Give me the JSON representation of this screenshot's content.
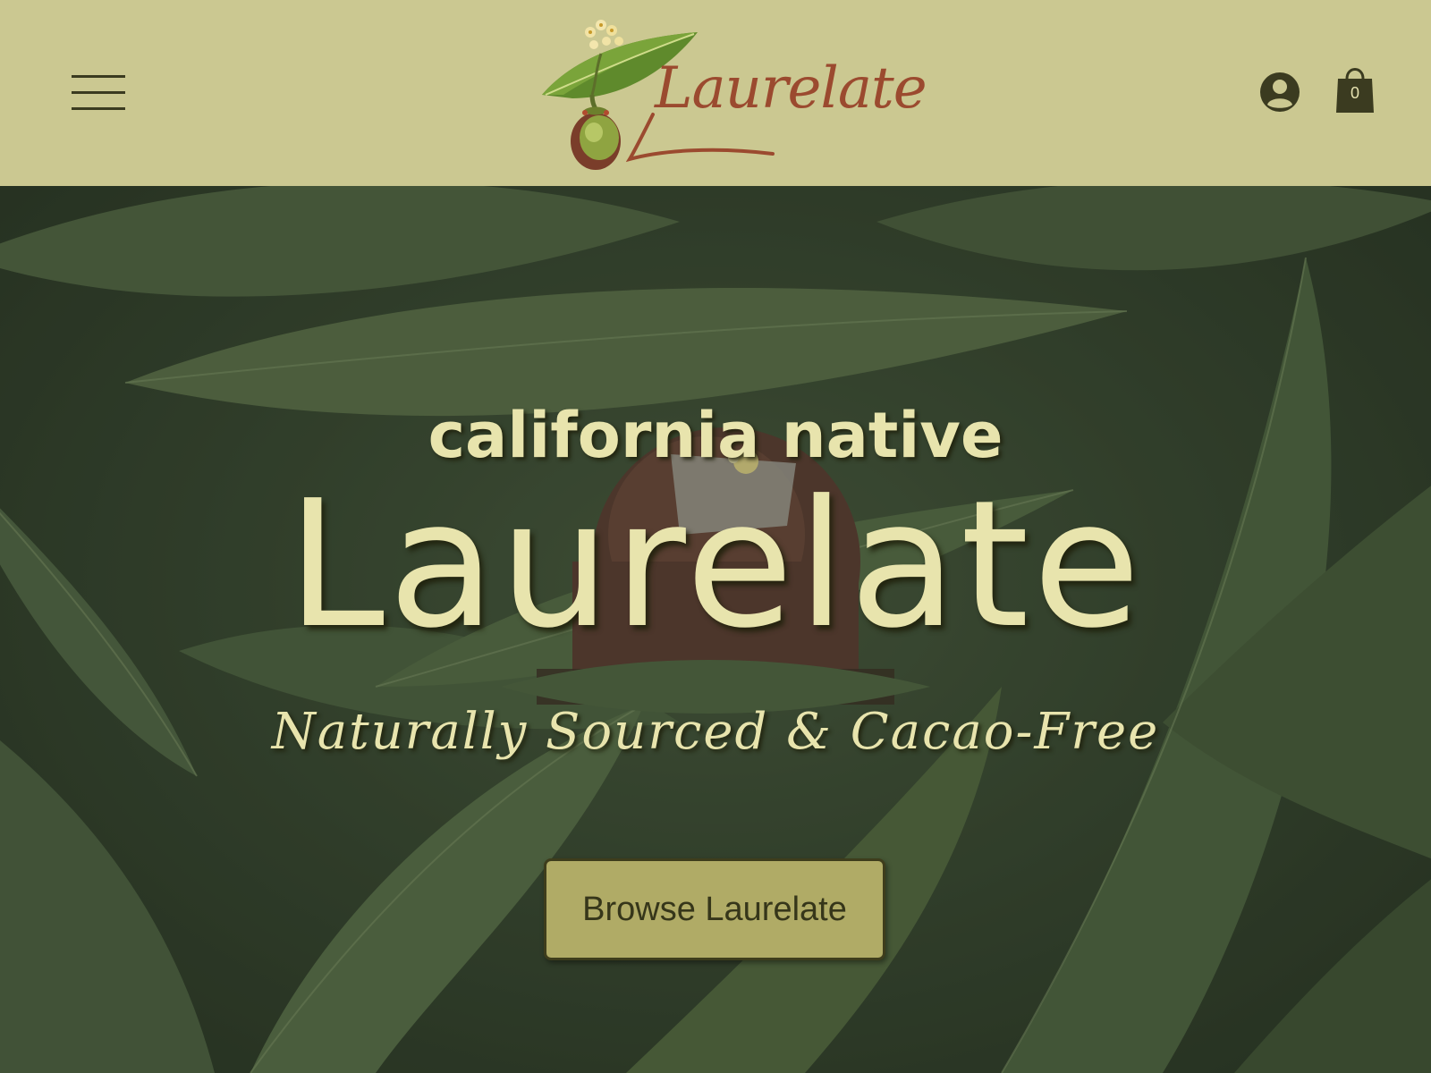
{
  "header": {
    "menu_icon": "hamburger-menu-icon",
    "logo": {
      "text": "Laurelate",
      "mark_icon": "laurel-leaf-fruit-icon"
    },
    "account_icon": "account-user-icon",
    "cart": {
      "icon": "shopping-bag-icon",
      "count": "0"
    }
  },
  "hero": {
    "kicker": "california native",
    "title": "Laurelate",
    "tagline": "Naturally Sourced & Cacao-Free",
    "cta_label": "Browse Laurelate",
    "background": "bay-laurel-leaves-with-chocolate-bonbon"
  },
  "colors": {
    "header_bg": "#cbc891",
    "hero_text": "#e8e4ad",
    "button_bg": "#b0ab66",
    "button_text": "#36361a",
    "logo_text": "#9b4a2f",
    "icon_dark": "#3b3b20"
  }
}
